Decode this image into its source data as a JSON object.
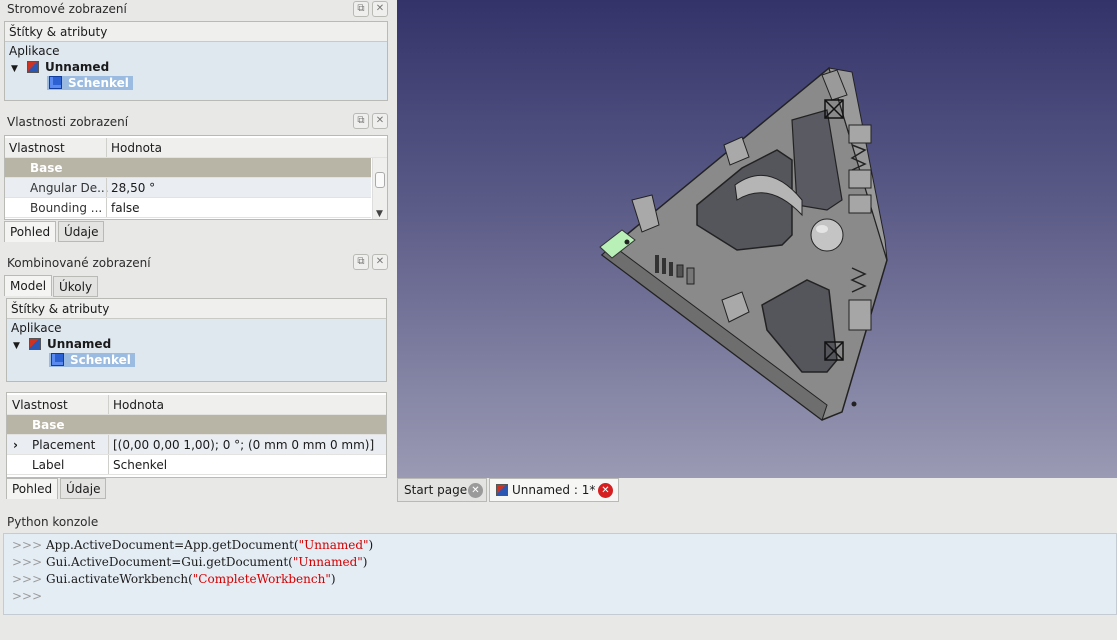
{
  "tree_panel": {
    "title": "Stromové zobrazení",
    "header": "Štítky & atributy",
    "root_label": "Aplikace",
    "document": "Unnamed",
    "object": "Schenkel"
  },
  "view_props_panel": {
    "title": "Vlastnosti zobrazení",
    "col_property": "Vlastnost",
    "col_value": "Hodnota",
    "group": "Base",
    "rows": [
      {
        "name": "Angular De...",
        "value": "28,50 °"
      },
      {
        "name": "Bounding ...",
        "value": "false"
      }
    ],
    "tabs": [
      "Pohled",
      "Údaje"
    ]
  },
  "combo_panel": {
    "title": "Kombinované zobrazení",
    "tabs": [
      "Model",
      "Úkoly"
    ],
    "tree_header": "Štítky & atributy",
    "root_label": "Aplikace",
    "document": "Unnamed",
    "object": "Schenkel",
    "col_property": "Vlastnost",
    "col_value": "Hodnota",
    "group": "Base",
    "rows": [
      {
        "name": "Placement",
        "value": "[(0,00 0,00 1,00); 0 °; (0 mm  0 mm  0 mm)]"
      },
      {
        "name": "Label",
        "value": "Schenkel"
      }
    ],
    "bottom_tabs": [
      "Pohled",
      "Údaje"
    ]
  },
  "document_tabs": [
    {
      "label": "Start page"
    },
    {
      "label": "Unnamed : 1*"
    }
  ],
  "python_console": {
    "title": "Python konzole",
    "prompt": ">>>",
    "lines": [
      {
        "code": "App.ActiveDocument=App.getDocument(",
        "str": "\"Unnamed\"",
        "end": ")"
      },
      {
        "code": "Gui.ActiveDocument=Gui.getDocument(",
        "str": "\"Unnamed\"",
        "end": ")"
      },
      {
        "code": "Gui.activateWorkbench(",
        "str": "\"CompleteWorkbench\"",
        "end": ")"
      }
    ]
  },
  "colors": {
    "viewport_top": "#33336a",
    "viewport_bottom": "#9a9ab4",
    "selection": "#9bbce0",
    "group_row": "#b8b4a6",
    "close_red": "#d42020"
  }
}
